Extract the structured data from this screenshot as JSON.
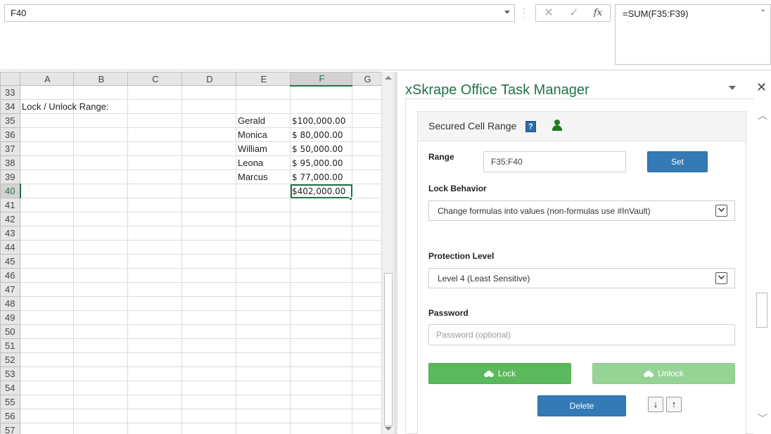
{
  "formula_bar": {
    "name_box": "F40",
    "formula": "=SUM(F35:F39)",
    "cancel_glyph": "✕",
    "enter_glyph": "✓",
    "fx_glyph": "fx"
  },
  "sheet": {
    "columns": [
      "A",
      "B",
      "C",
      "D",
      "E",
      "F",
      "G"
    ],
    "selected_cell": "F40",
    "rows": [
      {
        "num": "33",
        "a": "",
        "e": "",
        "f": ""
      },
      {
        "num": "34",
        "a": "Lock / Unlock Range:",
        "e": "",
        "f": ""
      },
      {
        "num": "35",
        "a": "",
        "e": "Gerald",
        "f": "$100,000.00"
      },
      {
        "num": "36",
        "a": "",
        "e": "Monica",
        "f": "$  80,000.00"
      },
      {
        "num": "37",
        "a": "",
        "e": "William",
        "f": "$  50,000.00"
      },
      {
        "num": "38",
        "a": "",
        "e": "Leona",
        "f": "$  95,000.00"
      },
      {
        "num": "39",
        "a": "",
        "e": "Marcus",
        "f": "$  77,000.00"
      },
      {
        "num": "40",
        "a": "",
        "e": "",
        "f": "$402,000.00"
      },
      {
        "num": "41",
        "a": "",
        "e": "",
        "f": ""
      },
      {
        "num": "42",
        "a": "",
        "e": "",
        "f": ""
      },
      {
        "num": "43",
        "a": "",
        "e": "",
        "f": ""
      },
      {
        "num": "44",
        "a": "",
        "e": "",
        "f": ""
      },
      {
        "num": "45",
        "a": "",
        "e": "",
        "f": ""
      },
      {
        "num": "46",
        "a": "",
        "e": "",
        "f": ""
      },
      {
        "num": "47",
        "a": "",
        "e": "",
        "f": ""
      },
      {
        "num": "48",
        "a": "",
        "e": "",
        "f": ""
      },
      {
        "num": "49",
        "a": "",
        "e": "",
        "f": ""
      },
      {
        "num": "50",
        "a": "",
        "e": "",
        "f": ""
      },
      {
        "num": "51",
        "a": "",
        "e": "",
        "f": ""
      },
      {
        "num": "52",
        "a": "",
        "e": "",
        "f": ""
      },
      {
        "num": "53",
        "a": "",
        "e": "",
        "f": ""
      },
      {
        "num": "54",
        "a": "",
        "e": "",
        "f": ""
      },
      {
        "num": "55",
        "a": "",
        "e": "",
        "f": ""
      },
      {
        "num": "56",
        "a": "",
        "e": "",
        "f": ""
      },
      {
        "num": "57",
        "a": "",
        "e": "",
        "f": ""
      }
    ]
  },
  "task_pane": {
    "title": "xSkrape Office Task Manager",
    "close_glyph": "✕",
    "card": {
      "title": "Secured Cell Range",
      "help_glyph": "?",
      "range": {
        "label": "Range",
        "value": "F35:F40",
        "button": "Set"
      },
      "lock_behavior": {
        "label": "Lock Behavior",
        "value": "Change formulas into values (non-formulas use #InVault)"
      },
      "protection_level": {
        "label": "Protection Level",
        "value": "Level 4 (Least Sensitive)"
      },
      "password": {
        "label": "Password",
        "placeholder": "Password (optional)"
      },
      "lock_button": "Lock",
      "unlock_button": "Unlock",
      "delete_button": "Delete",
      "move_down_glyph": "🡇",
      "move_up_glyph": "🡅"
    }
  },
  "colors": {
    "excel_green": "#217346",
    "primary_blue": "#337ab7",
    "success_green": "#5cb85c",
    "success_green_disabled": "#96d496",
    "user_icon_green": "#1e7a1e"
  },
  "icons": [
    "chevron-down-icon",
    "close-icon",
    "check-icon",
    "fx-icon",
    "help-icon",
    "user-icon",
    "cloud-upload-icon",
    "arrow-down-icon",
    "arrow-up-icon"
  ]
}
